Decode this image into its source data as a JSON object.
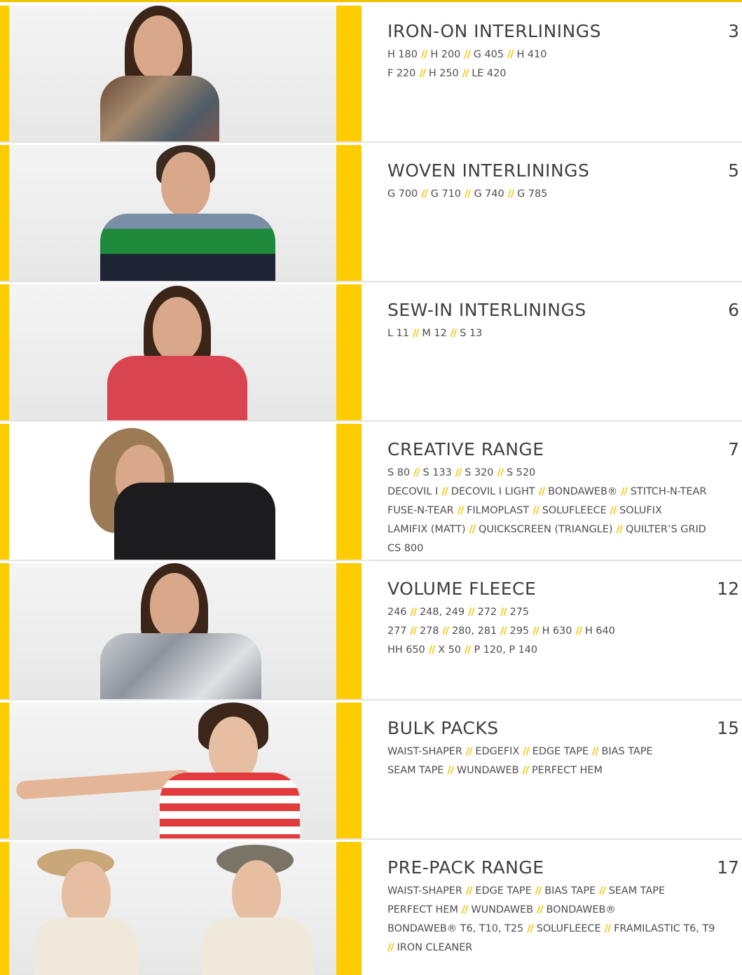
{
  "colors": {
    "accent": "#ffcc00",
    "separator": "#f5c400",
    "text": "#4a4a4a"
  },
  "separator": "//",
  "sections": [
    {
      "title": "IRON-ON INTERLININGS",
      "page": "3",
      "lines": [
        [
          "H 180",
          "H 200",
          "G 405",
          "H 410"
        ],
        [
          "F 220",
          "H 250",
          "LE 420"
        ]
      ]
    },
    {
      "title": "WOVEN INTERLININGS",
      "page": "5",
      "lines": [
        [
          "G 700",
          "G 710",
          "G 740",
          "G 785"
        ]
      ]
    },
    {
      "title": "SEW-IN INTERLININGS",
      "page": "6",
      "lines": [
        [
          "L 11",
          "M 12",
          "S 13"
        ]
      ]
    },
    {
      "title": "CREATIVE RANGE",
      "page": "7",
      "lines": [
        [
          "S 80",
          "S 133",
          "S 320",
          "S 520"
        ],
        [
          "DECOVIL I",
          "DECOVIL I LIGHT",
          "BONDAWEB®",
          "STITCH-N-TEAR"
        ],
        [
          "FUSE-N-TEAR",
          "FILMOPLAST",
          "SOLUFLEECE",
          "SOLUFIX"
        ],
        [
          "LAMIFIX (MATT)",
          "QUICKSCREEN (TRIANGLE)",
          "QUILTER’S GRID"
        ],
        [
          "CS 800"
        ]
      ]
    },
    {
      "title": "VOLUME FLEECE",
      "page": "12",
      "lines": [
        [
          "246",
          "248, 249",
          "272",
          "275"
        ],
        [
          "277",
          "278",
          "280, 281",
          "295",
          "H 630",
          "H 640"
        ],
        [
          "HH 650",
          "X 50",
          "P 120, P 140"
        ]
      ]
    },
    {
      "title": "BULK PACKS",
      "page": "15",
      "lines": [
        [
          "WAIST-SHAPER",
          "EDGEFIX",
          "EDGE TAPE",
          "BIAS TAPE"
        ],
        [
          "SEAM TAPE",
          "WUNDAWEB",
          "PERFECT HEM"
        ]
      ]
    },
    {
      "title": "PRE-PACK RANGE",
      "page": "17",
      "lines": [
        [
          "WAIST-SHAPER",
          "EDGE TAPE",
          "BIAS TAPE",
          "SEAM TAPE"
        ],
        [
          "PERFECT HEM",
          "WUNDAWEB",
          "BONDAWEB®"
        ],
        [
          "BONDAWEB® T6, T10, T25",
          "SOLUFLEECE",
          "FRAMILASTIC T6, T9"
        ],
        [
          "",
          "IRON CLEANER"
        ]
      ]
    }
  ]
}
